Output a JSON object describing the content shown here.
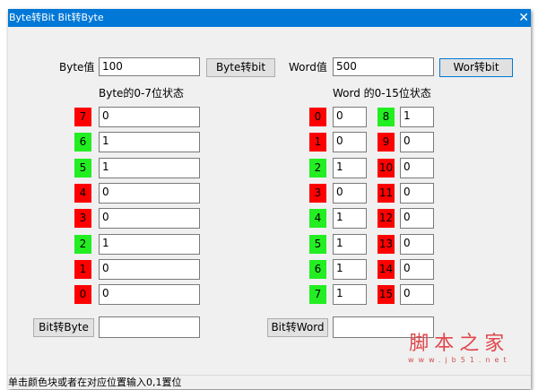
{
  "window": {
    "title": "Byte转Bit Bit转Byte",
    "close": "✕"
  },
  "byte": {
    "label": "Byte值",
    "value": "100",
    "convert_button": "Byte转bit",
    "section_title": "Byte的0-7位状态",
    "back_button": "Bit转Byte",
    "back_value": "",
    "bits": [
      {
        "index": "7",
        "value": "0"
      },
      {
        "index": "6",
        "value": "1"
      },
      {
        "index": "5",
        "value": "1"
      },
      {
        "index": "4",
        "value": "0"
      },
      {
        "index": "3",
        "value": "0"
      },
      {
        "index": "2",
        "value": "1"
      },
      {
        "index": "1",
        "value": "0"
      },
      {
        "index": "0",
        "value": "0"
      }
    ]
  },
  "word": {
    "label": "Word值",
    "value": "500",
    "convert_button": "Wor转bit",
    "section_title": "Word 的0-15位状态",
    "back_button": "Bit转Word",
    "back_value": "",
    "bits": [
      {
        "index": "0",
        "value": "0"
      },
      {
        "index": "1",
        "value": "0"
      },
      {
        "index": "2",
        "value": "1"
      },
      {
        "index": "3",
        "value": "0"
      },
      {
        "index": "4",
        "value": "1"
      },
      {
        "index": "5",
        "value": "1"
      },
      {
        "index": "6",
        "value": "1"
      },
      {
        "index": "7",
        "value": "1"
      },
      {
        "index": "8",
        "value": "1"
      },
      {
        "index": "9",
        "value": "0"
      },
      {
        "index": "10",
        "value": "0"
      },
      {
        "index": "11",
        "value": "0"
      },
      {
        "index": "12",
        "value": "0"
      },
      {
        "index": "13",
        "value": "0"
      },
      {
        "index": "14",
        "value": "0"
      },
      {
        "index": "15",
        "value": "0"
      }
    ]
  },
  "colors": {
    "on": "#22ee22",
    "off": "#ff0000"
  },
  "status": "单击颜色块或者在对应位置输入0,1置位",
  "watermark": {
    "name": "脚本之家",
    "url": "www.jb51.net"
  }
}
